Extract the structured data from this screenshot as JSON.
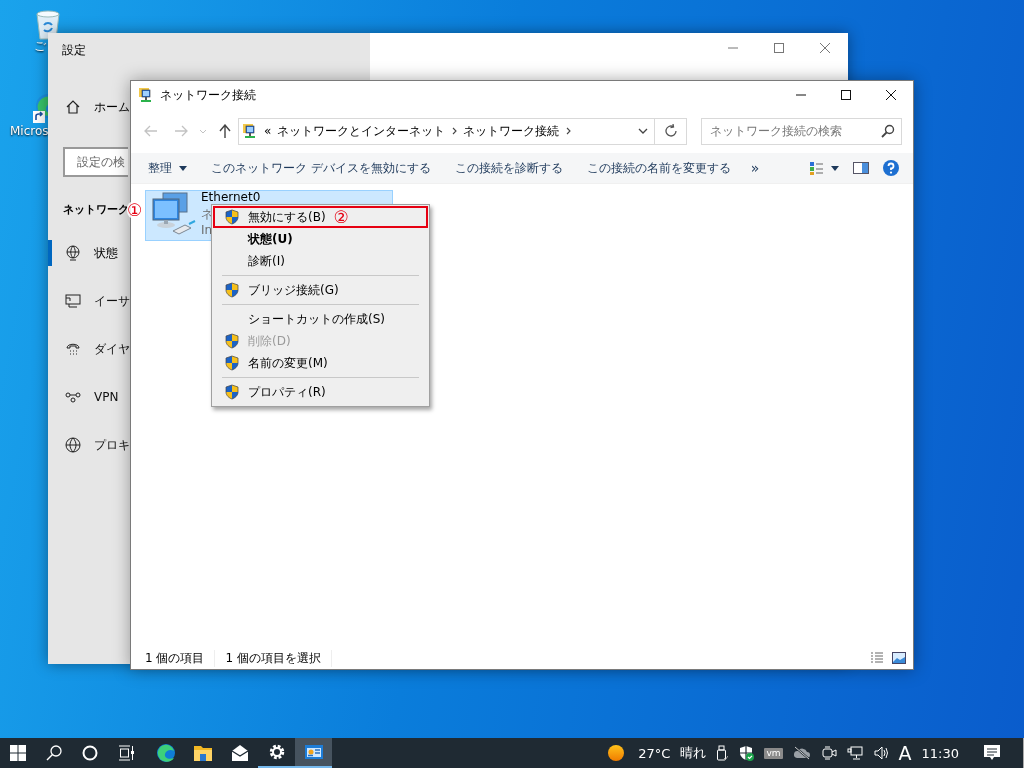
{
  "desktop_icons": [
    {
      "label": "ご"
    },
    {
      "label": "Micros"
    }
  ],
  "settings_window": {
    "title": "設定",
    "home": "ホーム",
    "search": {
      "placeholder": "設定の検"
    },
    "section_title": "ネットワーク",
    "nav_items": [
      {
        "label": "状態",
        "selected": true
      },
      {
        "label": "イーサ",
        "selected": false
      },
      {
        "label": "ダイヤ",
        "selected": false
      },
      {
        "label": "VPN",
        "selected": false
      },
      {
        "label": "プロキ",
        "selected": false
      }
    ]
  },
  "explorer_window": {
    "title": "ネットワーク接続",
    "address": {
      "overflow": "«",
      "segments": [
        "ネットワークとインターネット",
        "ネットワーク接続"
      ]
    },
    "search": {
      "placeholder": "ネットワーク接続の検索"
    },
    "commands": [
      {
        "label": "整理",
        "dropdown": true
      },
      {
        "label": "このネットワーク デバイスを無効にする",
        "dropdown": false
      },
      {
        "label": "この接続を診断する",
        "dropdown": false
      },
      {
        "label": "この接続の名前を変更する",
        "dropdown": false
      }
    ],
    "more": "»",
    "items": [
      {
        "name": "Ethernet0",
        "line_2": "ネ",
        "line_3": "In",
        "selected": true,
        "callout": "①"
      }
    ],
    "status_bar": [
      "1 個の項目",
      "1 個の項目を選択"
    ]
  },
  "context_menu": {
    "items": [
      {
        "kind": "command",
        "label": "無効にする(B)",
        "shield": true,
        "bold": false,
        "disabled": false,
        "marked": true,
        "callout": "②"
      },
      {
        "kind": "command",
        "label": "状態(U)",
        "shield": false,
        "bold": true,
        "disabled": false,
        "marked": false
      },
      {
        "kind": "command",
        "label": "診断(I)",
        "shield": false,
        "bold": false,
        "disabled": false,
        "marked": false
      },
      {
        "kind": "separator"
      },
      {
        "kind": "command",
        "label": "ブリッジ接続(G)",
        "shield": true,
        "bold": false,
        "disabled": false,
        "marked": false
      },
      {
        "kind": "separator"
      },
      {
        "kind": "command",
        "label": "ショートカットの作成(S)",
        "shield": false,
        "bold": false,
        "disabled": false,
        "marked": false
      },
      {
        "kind": "command",
        "label": "削除(D)",
        "shield": true,
        "bold": false,
        "disabled": true,
        "marked": false
      },
      {
        "kind": "command",
        "label": "名前の変更(M)",
        "shield": true,
        "bold": false,
        "disabled": false,
        "marked": false
      },
      {
        "kind": "separator"
      },
      {
        "kind": "command",
        "label": "プロパティ(R)",
        "shield": true,
        "bold": false,
        "disabled": false,
        "marked": false
      }
    ]
  },
  "taskbar": {
    "apps": [
      {
        "kind": "browser",
        "running": false,
        "selected": false
      },
      {
        "kind": "folder",
        "running": false,
        "selected": false
      },
      {
        "kind": "mail",
        "running": false,
        "selected": false
      },
      {
        "kind": "settings",
        "running": true,
        "selected": false
      },
      {
        "kind": "network",
        "running": true,
        "selected": true
      }
    ],
    "weather": {
      "temperature": "27°C",
      "condition": "晴れ"
    },
    "vm_badge": "vm",
    "ime": "A",
    "clock": "11:30"
  }
}
